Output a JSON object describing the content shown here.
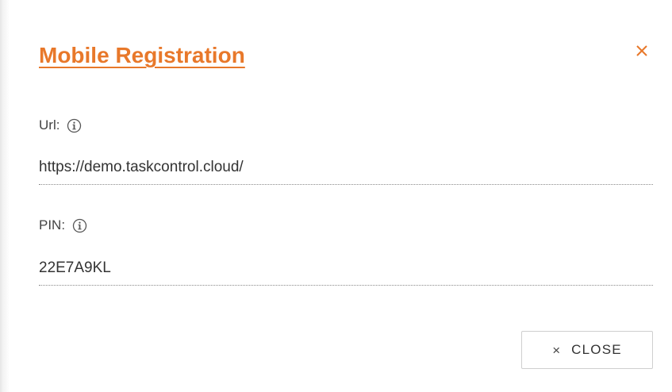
{
  "dialog": {
    "title": "Mobile Registration",
    "close_icon": "close-icon",
    "accent_color": "#e8782a"
  },
  "fields": {
    "url": {
      "label": "Url:",
      "value": "https://demo.taskcontrol.cloud/",
      "icon": "info-icon"
    },
    "pin": {
      "label": "PIN:",
      "value": "22E7A9KL",
      "icon": "info-icon"
    }
  },
  "footer": {
    "close_button_label": "CLOSE",
    "close_button_icon": "close-icon"
  }
}
